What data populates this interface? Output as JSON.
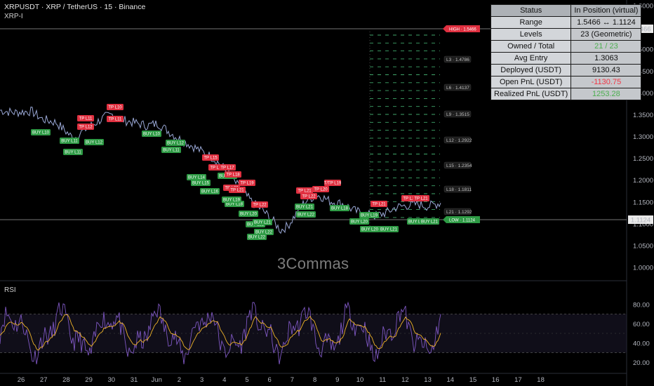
{
  "header": {
    "title": "XRPUSDT · XRP / TetherUS · 15 · Binance",
    "subtitle": "XRP-I"
  },
  "watermark": "3Commas",
  "rsi_pane": {
    "label": "RSI"
  },
  "colors": {
    "background": "#000000",
    "price_line": "#9aa8d6",
    "buy_tag": "#2e9b45",
    "tp_tag": "#e03040",
    "grid_level": "#3fa66a",
    "rsi_line": "#7e57c2",
    "rsi_ma": "#f0b429",
    "rsi_band": "#1e1a2e"
  },
  "stats_table": {
    "header": {
      "label": "Status",
      "value": "In Position (virtual)"
    },
    "rows": [
      {
        "label": "Range",
        "value": "1.5466 ↔ 1.1124",
        "tone": "normal"
      },
      {
        "label": "Levels",
        "value": "23 (Geometric)",
        "tone": "normal"
      },
      {
        "label": "Owned / Total",
        "value": "21 / 23",
        "tone": "green"
      },
      {
        "label": "Avg Entry",
        "value": "1.3063",
        "tone": "normal"
      },
      {
        "label": "Deployed (USDT)",
        "value": "9130.43",
        "tone": "normal"
      },
      {
        "label": "Open PnL (USDT)",
        "value": "-1130.75",
        "tone": "red"
      },
      {
        "label": "Realized PnL (USDT)",
        "value": "1253.28",
        "tone": "green"
      }
    ]
  },
  "price_axis": {
    "ticks": [
      "1.6000",
      "1.5500",
      "1.5000",
      "1.4500",
      "1.4000",
      "1.3500",
      "1.3000",
      "1.2500",
      "1.2000",
      "1.1500",
      "1.1000",
      "1.0500",
      "1.0000"
    ],
    "high_tag": "1.5466",
    "low_tag": "1.1124"
  },
  "range_lines": {
    "high_label": "HIGH · 1.5466",
    "low_label": "LOW · 1.1124"
  },
  "grid_level_labels": [
    "L3 · 1.4786",
    "L6 · 1.4137",
    "L9 · 1.3515",
    "L12 · 1.2922",
    "L15 · 1.2354",
    "L18 · 1.1811",
    "L21 · 1.1292"
  ],
  "rsi_axis": {
    "ticks": [
      "80.00",
      "60.00",
      "40.00",
      "20.00"
    ]
  },
  "time_axis": {
    "labels": [
      "26",
      "27",
      "28",
      "29",
      "30",
      "31",
      "Jun",
      "2",
      "3",
      "4",
      "5",
      "6",
      "7",
      "8",
      "9",
      "10",
      "11",
      "12",
      "13",
      "14",
      "15",
      "16",
      "17",
      "18"
    ]
  },
  "trade_tags": {
    "buy": [
      "BUY L10",
      "BUY L11",
      "BUY L12",
      "BUY L11",
      "BUY L10",
      "BUY L11",
      "BUY L12",
      "BUY L14",
      "BUY L15",
      "BUY L16",
      "BUY L17",
      "BUY L18",
      "BUY L19",
      "BUY L20",
      "BUY L21",
      "BUY L22",
      "BUY L21",
      "BUY L22",
      "BUY L22",
      "BUY L20",
      "BUY L21",
      "BUY L18",
      "BUY L19",
      "BUY L20",
      "BUY L21",
      "BUY L22",
      "BUY L21"
    ],
    "tp": [
      "TP L10",
      "TP L11",
      "TP L12",
      "TP L11",
      "TP L15",
      "TP L16",
      "TP L17",
      "TP L18",
      "TP L19",
      "TP L20",
      "TP L21",
      "TP L22",
      "TP L21",
      "TP L22",
      "T/TP L19",
      "TP L20",
      "TP L21",
      "TP L21",
      "TP L21"
    ]
  }
}
